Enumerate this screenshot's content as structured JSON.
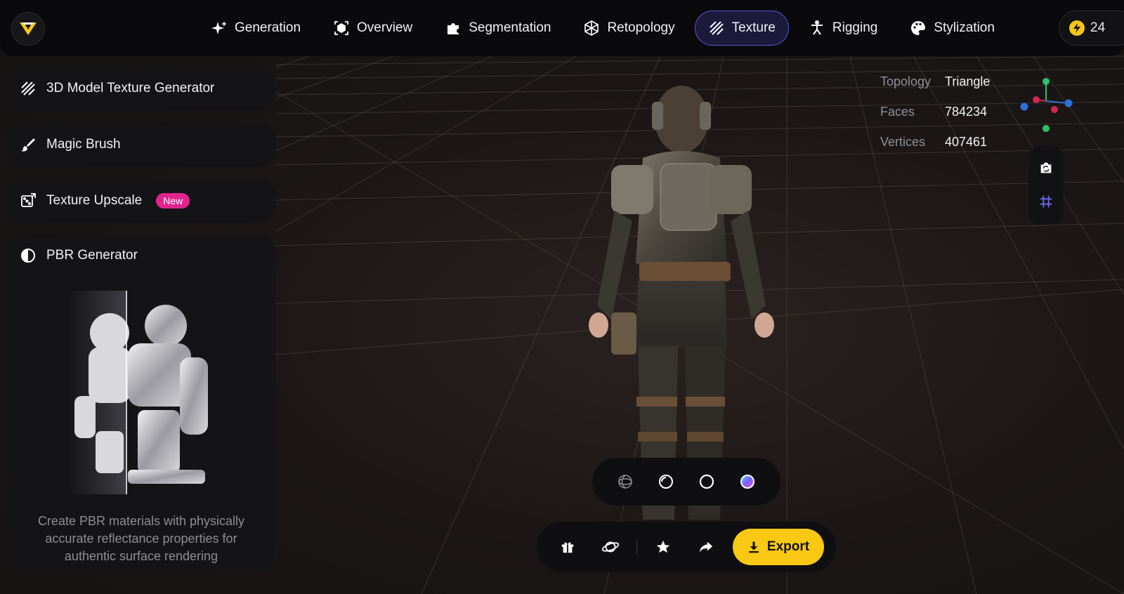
{
  "header": {
    "nav": [
      {
        "label": "Generation",
        "icon": "sparkle-icon",
        "active": false
      },
      {
        "label": "Overview",
        "icon": "cube-box-icon",
        "active": false
      },
      {
        "label": "Segmentation",
        "icon": "puzzle-icon",
        "active": false
      },
      {
        "label": "Retopology",
        "icon": "polyhedron-icon",
        "active": false
      },
      {
        "label": "Texture",
        "icon": "diagonal-stripes-icon",
        "active": true
      },
      {
        "label": "Rigging",
        "icon": "person-icon",
        "active": false
      },
      {
        "label": "Stylization",
        "icon": "palette-icon",
        "active": false
      }
    ],
    "credits": "24"
  },
  "sidebar": {
    "items": [
      {
        "label": "3D Model Texture Generator",
        "icon": "diagonal-stripes-icon"
      },
      {
        "label": "Magic Brush",
        "icon": "brush-icon"
      },
      {
        "label": "Texture Upscale",
        "icon": "upscale-dice-icon",
        "badge": "New"
      }
    ],
    "pbr": {
      "title": "PBR Generator",
      "icon": "half-circle-icon",
      "description": "Create PBR materials with physically accurate reflectance properties for authentic surface rendering"
    }
  },
  "stats": [
    {
      "label": "Topology",
      "value": "Triangle"
    },
    {
      "label": "Faces",
      "value": "784234"
    },
    {
      "label": "Vertices",
      "value": "407461"
    }
  ],
  "tools": [
    "camera-rotate-icon",
    "grid-hash-icon"
  ],
  "shading_modes": [
    "wireframe-sphere-icon",
    "clay-sphere-icon",
    "outline-sphere-icon",
    "color-sphere-icon"
  ],
  "actions": {
    "icons": [
      "gift-icon",
      "planet-icon",
      "star-icon",
      "share-arrow-icon"
    ],
    "export_label": "Export"
  },
  "colors": {
    "accent": "#5b54e0",
    "export": "#f8c813",
    "badge": "#e0248f"
  }
}
